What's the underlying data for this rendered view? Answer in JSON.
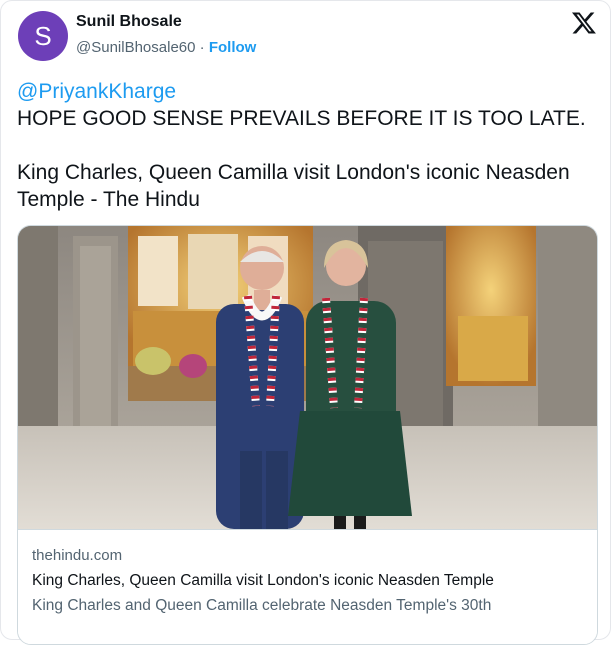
{
  "author": {
    "avatar_letter": "S",
    "avatar_color": "#6d3fb8",
    "name": "Sunil Bhosale",
    "handle": "@SunilBhosale60",
    "separator": "·",
    "follow_label": "Follow"
  },
  "tweet": {
    "mention": "@PriyankKharge",
    "line1": "HOPE GOOD SENSE PREVAILS BEFORE IT IS TOO LATE.",
    "line2": "King Charles, Queen Camilla visit London's iconic Neasden",
    "line3": "Temple - The Hindu"
  },
  "link_card": {
    "domain": "thehindu.com",
    "title": "King Charles, Queen Camilla visit London's iconic Neasden Temple",
    "description": "King Charles and Queen Camilla celebrate Neasden Temple's 30th"
  },
  "icons": {
    "logo": "x-logo-icon",
    "avatar": "letter-avatar"
  },
  "colors": {
    "link": "#1d9bf0",
    "text": "#0f1419",
    "muted": "#536471",
    "border": "#cfd9de"
  }
}
